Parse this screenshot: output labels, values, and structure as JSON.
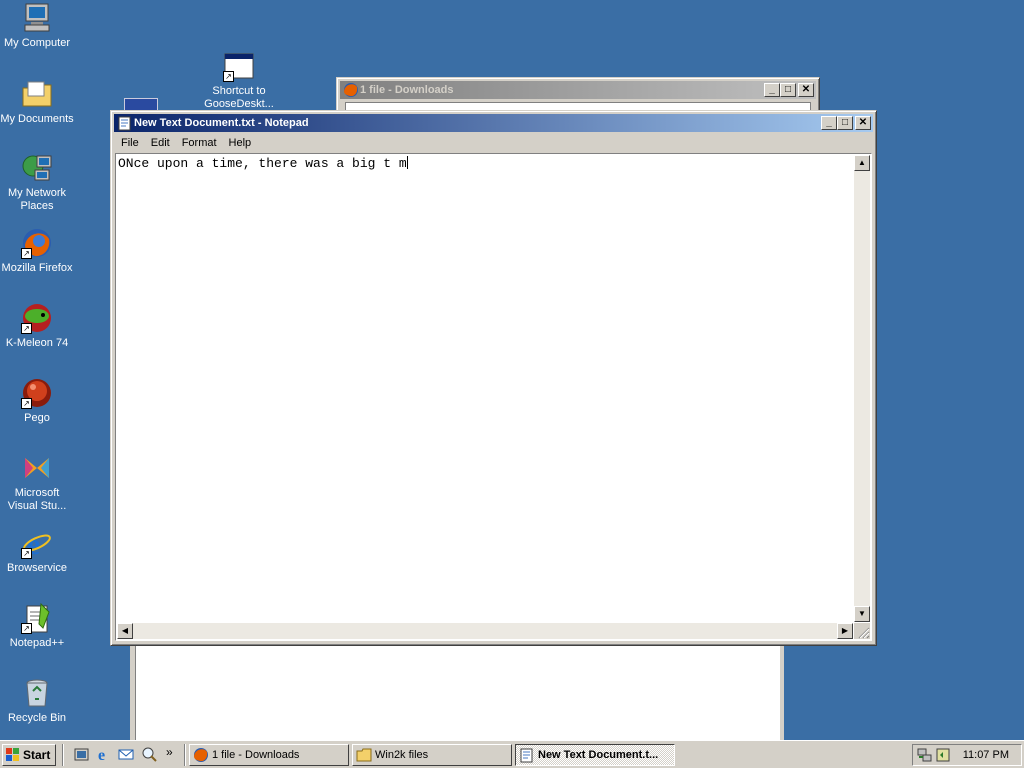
{
  "desktop": {
    "icons": [
      {
        "label": "My Computer",
        "icon": "computer-icon"
      },
      {
        "label": "My Documents",
        "icon": "folder-documents-icon"
      },
      {
        "label": "My Network Places",
        "icon": "network-icon"
      },
      {
        "label": "Mozilla Firefox",
        "icon": "firefox-icon"
      },
      {
        "label": "K-Meleon 74",
        "icon": "kmeleon-icon"
      },
      {
        "label": "Pego",
        "icon": "pego-icon"
      },
      {
        "label": "Microsoft Visual Stu...",
        "icon": "visual-studio-icon"
      },
      {
        "label": "Browservice",
        "icon": "ie-icon"
      },
      {
        "label": "Notepad++",
        "icon": "notepadpp-icon"
      },
      {
        "label": "Recycle Bin",
        "icon": "recycle-bin-icon"
      },
      {
        "label": "Shortcut to GooseDeskt...",
        "icon": "window-shortcut-icon"
      }
    ],
    "background": "#3a6ea5"
  },
  "downloads_window": {
    "title": "1 file - Downloads"
  },
  "notepad": {
    "title": "New Text Document.txt - Notepad",
    "menu": [
      "File",
      "Edit",
      "Format",
      "Help"
    ],
    "content": "ONce upon a time, there was a big t m"
  },
  "taskbar": {
    "start_label": "Start",
    "overflow": "»",
    "buttons": [
      {
        "label": "1 file - Downloads",
        "icon": "firefox-icon",
        "active": false
      },
      {
        "label": "Win2k files",
        "icon": "folder-icon",
        "active": false
      },
      {
        "label": "New Text Document.t...",
        "icon": "notepad-icon",
        "active": true
      }
    ],
    "clock": "11:07 PM"
  },
  "colors": {
    "titlebar_active_start": "#0a246a",
    "titlebar_active_end": "#a6caf0",
    "face": "#d4d0c8"
  }
}
